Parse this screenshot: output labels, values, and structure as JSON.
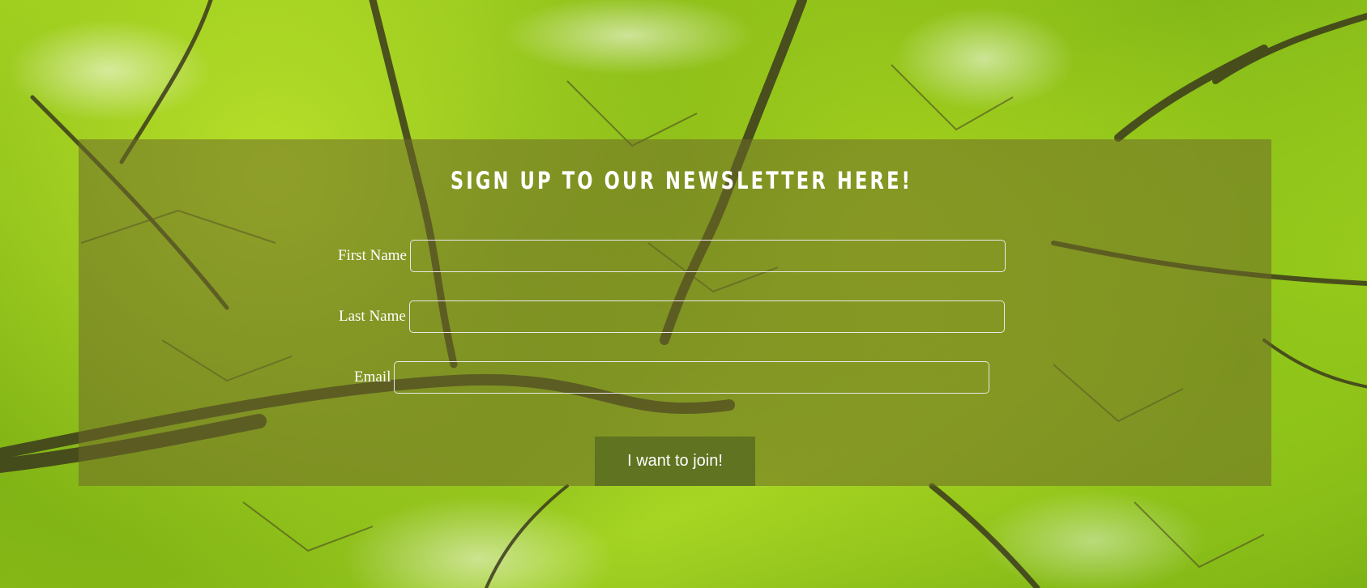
{
  "newsletter": {
    "title": "SIGN UP TO OUR NEWSLETTER HERE!",
    "fields": {
      "first_name": {
        "label": "First Name",
        "value": ""
      },
      "last_name": {
        "label": "Last Name",
        "value": ""
      },
      "email": {
        "label": "Email",
        "value": ""
      }
    },
    "submit_label": "I want to join!"
  },
  "colors": {
    "panel_overlay": "#6e6928",
    "button": "#5f7320",
    "text": "#ffffff"
  }
}
